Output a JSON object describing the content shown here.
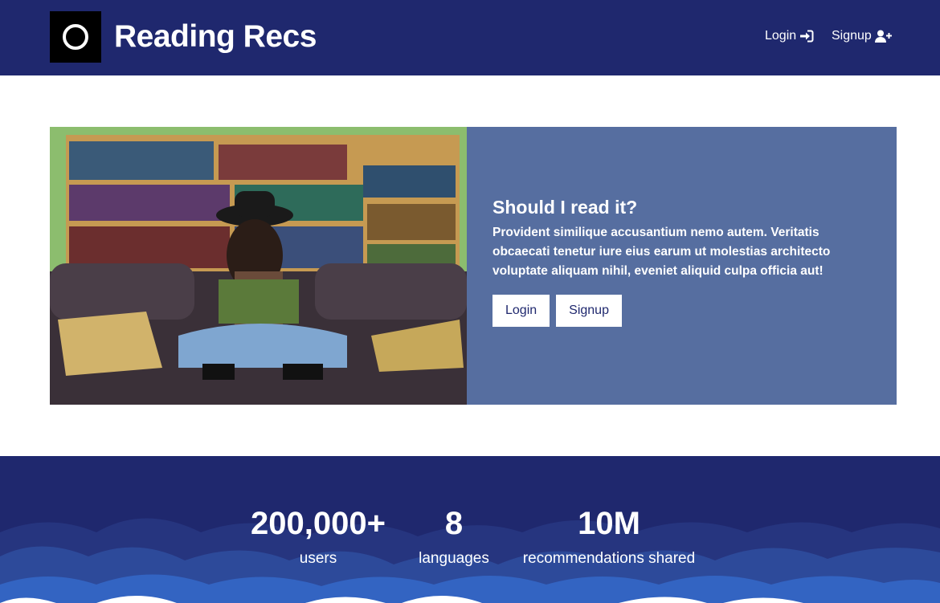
{
  "header": {
    "brand": "Reading Recs",
    "logo_icon": "circle-logo-icon",
    "nav": {
      "login_label": "Login",
      "login_icon": "sign-in-icon",
      "signup_label": "Signup",
      "signup_icon": "user-plus-icon"
    }
  },
  "hero": {
    "image_description_icon": "photo-woman-reading-icon",
    "title": "Should I read it?",
    "text": "Provident similique accusantium nemo autem. Veritatis obcaecati tenetur iure eius earum ut molestias architecto voluptate aliquam nihil, eveniet aliquid culpa officia aut!",
    "login_button": "Login",
    "signup_button": "Signup"
  },
  "stats": [
    {
      "value": "200,000+",
      "label": "users"
    },
    {
      "value": "8",
      "label": "languages"
    },
    {
      "value": "10M",
      "label": "recommendations shared"
    }
  ],
  "colors": {
    "navbar": "#1f286e",
    "hero_panel": "#566ea0",
    "button_bg": "#ffffff",
    "button_text": "#1f286e"
  }
}
